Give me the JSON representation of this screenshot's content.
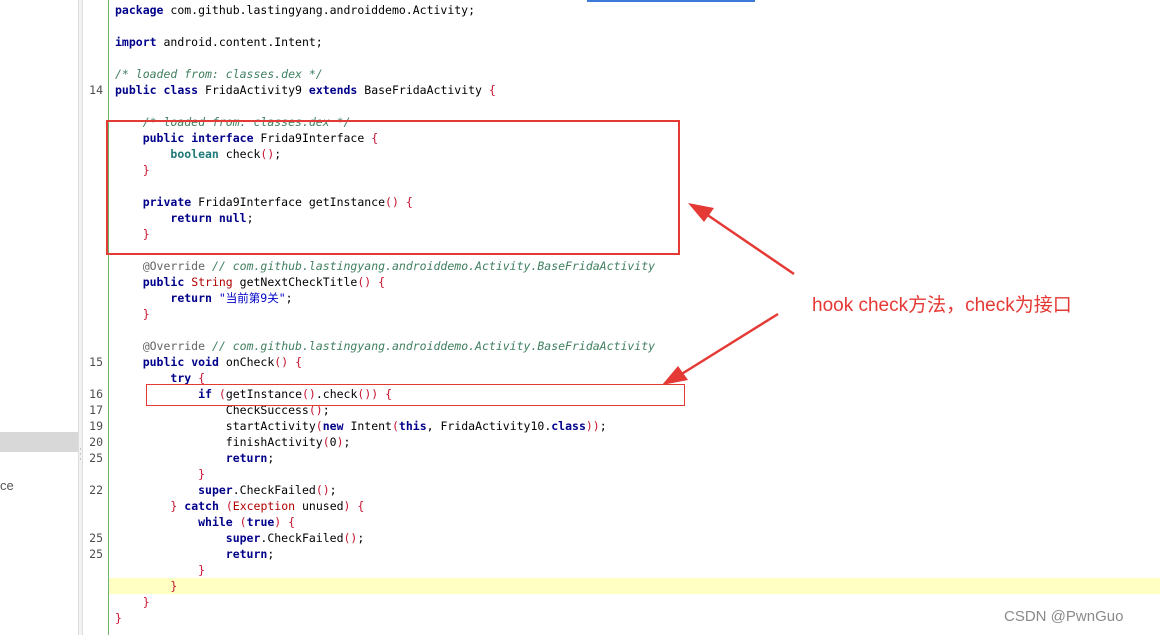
{
  "left_panel": {
    "partial_label": "ce"
  },
  "editor": {
    "lines": [
      {
        "num": "",
        "segs": [
          {
            "t": "package",
            "c": "kw"
          },
          {
            "t": " com.github.lastingyang.androiddemo.Activity;"
          }
        ]
      },
      {
        "num": "",
        "segs": []
      },
      {
        "num": "",
        "segs": [
          {
            "t": "import",
            "c": "kw"
          },
          {
            "t": " android.content.Intent;"
          }
        ]
      },
      {
        "num": "",
        "segs": []
      },
      {
        "num": "",
        "segs": [
          {
            "t": "/* loaded from: classes.dex */",
            "c": "cm"
          }
        ]
      },
      {
        "num": "14",
        "segs": [
          {
            "t": "public",
            "c": "kw"
          },
          {
            "t": " "
          },
          {
            "t": "class",
            "c": "kw"
          },
          {
            "t": " FridaActivity9 "
          },
          {
            "t": "extends",
            "c": "kw"
          },
          {
            "t": " BaseFridaActivity "
          },
          {
            "t": "{",
            "c": "rd"
          }
        ]
      },
      {
        "num": "",
        "segs": []
      },
      {
        "num": "",
        "segs": [
          {
            "t": "    "
          },
          {
            "t": "/* loaded from: classes.dex */",
            "c": "cm"
          }
        ]
      },
      {
        "num": "",
        "segs": [
          {
            "t": "    "
          },
          {
            "t": "public",
            "c": "kw"
          },
          {
            "t": " "
          },
          {
            "t": "interface",
            "c": "kw"
          },
          {
            "t": " Frida9Interface "
          },
          {
            "t": "{",
            "c": "rd"
          }
        ]
      },
      {
        "num": "",
        "segs": [
          {
            "t": "        "
          },
          {
            "t": "boolean",
            "c": "tp"
          },
          {
            "t": " check"
          },
          {
            "t": "()",
            "c": "rd"
          },
          {
            "t": ";"
          }
        ]
      },
      {
        "num": "",
        "segs": [
          {
            "t": "    "
          },
          {
            "t": "}",
            "c": "rd"
          }
        ]
      },
      {
        "num": "",
        "segs": []
      },
      {
        "num": "",
        "segs": [
          {
            "t": "    "
          },
          {
            "t": "private",
            "c": "kw"
          },
          {
            "t": " Frida9Interface getInstance"
          },
          {
            "t": "()",
            "c": "rd"
          },
          {
            "t": " "
          },
          {
            "t": "{",
            "c": "rd"
          }
        ]
      },
      {
        "num": "",
        "segs": [
          {
            "t": "        "
          },
          {
            "t": "return",
            "c": "kw"
          },
          {
            "t": " "
          },
          {
            "t": "null",
            "c": "kw"
          },
          {
            "t": ";"
          }
        ]
      },
      {
        "num": "",
        "segs": [
          {
            "t": "    "
          },
          {
            "t": "}",
            "c": "rd"
          }
        ]
      },
      {
        "num": "",
        "segs": []
      },
      {
        "num": "",
        "segs": [
          {
            "t": "    "
          },
          {
            "t": "@Override",
            "c": "an"
          },
          {
            "t": " "
          },
          {
            "t": "// com.github.lastingyang.androiddemo.Activity.BaseFridaActivity",
            "c": "cm"
          }
        ]
      },
      {
        "num": "",
        "segs": [
          {
            "t": "    "
          },
          {
            "t": "public",
            "c": "kw"
          },
          {
            "t": " "
          },
          {
            "t": "String",
            "c": "cl"
          },
          {
            "t": " getNextCheckTitle"
          },
          {
            "t": "()",
            "c": "rd"
          },
          {
            "t": " "
          },
          {
            "t": "{",
            "c": "rd"
          }
        ]
      },
      {
        "num": "",
        "segs": [
          {
            "t": "        "
          },
          {
            "t": "return",
            "c": "kw"
          },
          {
            "t": " "
          },
          {
            "t": "\"当前第9关\"",
            "c": "st"
          },
          {
            "t": ";"
          }
        ]
      },
      {
        "num": "",
        "segs": [
          {
            "t": "    "
          },
          {
            "t": "}",
            "c": "rd"
          }
        ]
      },
      {
        "num": "",
        "segs": []
      },
      {
        "num": "",
        "segs": [
          {
            "t": "    "
          },
          {
            "t": "@Override",
            "c": "an"
          },
          {
            "t": " "
          },
          {
            "t": "// com.github.lastingyang.androiddemo.Activity.BaseFridaActivity",
            "c": "cm"
          }
        ]
      },
      {
        "num": "15",
        "segs": [
          {
            "t": "    "
          },
          {
            "t": "public",
            "c": "kw"
          },
          {
            "t": " "
          },
          {
            "t": "void",
            "c": "kw"
          },
          {
            "t": " onCheck"
          },
          {
            "t": "()",
            "c": "rd"
          },
          {
            "t": " "
          },
          {
            "t": "{",
            "c": "rd"
          }
        ]
      },
      {
        "num": "",
        "segs": [
          {
            "t": "        "
          },
          {
            "t": "try",
            "c": "kw"
          },
          {
            "t": " "
          },
          {
            "t": "{",
            "c": "rd"
          }
        ]
      },
      {
        "num": "16",
        "segs": [
          {
            "t": "            "
          },
          {
            "t": "if",
            "c": "kw"
          },
          {
            "t": " "
          },
          {
            "t": "(",
            "c": "rd"
          },
          {
            "t": "getInstance"
          },
          {
            "t": "()",
            "c": "rd"
          },
          {
            "t": ".check"
          },
          {
            "t": "())",
            "c": "rd"
          },
          {
            "t": " "
          },
          {
            "t": "{",
            "c": "rd"
          }
        ]
      },
      {
        "num": "17",
        "segs": [
          {
            "t": "                CheckSuccess"
          },
          {
            "t": "()",
            "c": "rd"
          },
          {
            "t": ";"
          }
        ]
      },
      {
        "num": "19",
        "segs": [
          {
            "t": "                startActivity"
          },
          {
            "t": "(",
            "c": "rd"
          },
          {
            "t": "new",
            "c": "kw"
          },
          {
            "t": " Intent"
          },
          {
            "t": "(",
            "c": "rd"
          },
          {
            "t": "this",
            "c": "kw"
          },
          {
            "t": ", FridaActivity10."
          },
          {
            "t": "class",
            "c": "kw"
          },
          {
            "t": "))",
            "c": "rd"
          },
          {
            "t": ";"
          }
        ]
      },
      {
        "num": "20",
        "segs": [
          {
            "t": "                finishActivity"
          },
          {
            "t": "(",
            "c": "rd"
          },
          {
            "t": "0"
          },
          {
            "t": ")",
            "c": "rd"
          },
          {
            "t": ";"
          }
        ]
      },
      {
        "num": "25",
        "segs": [
          {
            "t": "                "
          },
          {
            "t": "return",
            "c": "kw"
          },
          {
            "t": ";"
          }
        ]
      },
      {
        "num": "",
        "segs": [
          {
            "t": "            "
          },
          {
            "t": "}",
            "c": "rd"
          }
        ]
      },
      {
        "num": "22",
        "segs": [
          {
            "t": "            "
          },
          {
            "t": "super",
            "c": "kw"
          },
          {
            "t": ".CheckFailed"
          },
          {
            "t": "()",
            "c": "rd"
          },
          {
            "t": ";"
          }
        ]
      },
      {
        "num": "",
        "segs": [
          {
            "t": "        "
          },
          {
            "t": "}",
            "c": "rd"
          },
          {
            "t": " "
          },
          {
            "t": "catch",
            "c": "kw"
          },
          {
            "t": " "
          },
          {
            "t": "(",
            "c": "rd"
          },
          {
            "t": "Exception",
            "c": "cl"
          },
          {
            "t": " unused"
          },
          {
            "t": ")",
            "c": "rd"
          },
          {
            "t": " "
          },
          {
            "t": "{",
            "c": "rd"
          }
        ]
      },
      {
        "num": "",
        "segs": [
          {
            "t": "            "
          },
          {
            "t": "while",
            "c": "kw"
          },
          {
            "t": " "
          },
          {
            "t": "(",
            "c": "rd"
          },
          {
            "t": "true",
            "c": "kw"
          },
          {
            "t": ")",
            "c": "rd"
          },
          {
            "t": " "
          },
          {
            "t": "{",
            "c": "rd"
          }
        ]
      },
      {
        "num": "25",
        "segs": [
          {
            "t": "                "
          },
          {
            "t": "super",
            "c": "kw"
          },
          {
            "t": ".CheckFailed"
          },
          {
            "t": "()",
            "c": "rd"
          },
          {
            "t": ";"
          }
        ]
      },
      {
        "num": "25",
        "segs": [
          {
            "t": "                "
          },
          {
            "t": "return",
            "c": "kw"
          },
          {
            "t": ";"
          }
        ]
      },
      {
        "num": "",
        "segs": [
          {
            "t": "            "
          },
          {
            "t": "}",
            "c": "rd"
          }
        ]
      },
      {
        "num": "",
        "segs": [
          {
            "t": "        "
          },
          {
            "t": "}",
            "c": "rd"
          }
        ]
      },
      {
        "num": "",
        "segs": [
          {
            "t": "    "
          },
          {
            "t": "}",
            "c": "rd"
          }
        ]
      },
      {
        "num": "",
        "segs": [
          {
            "t": "}",
            "c": "rd"
          }
        ]
      }
    ],
    "current_line": 36
  },
  "annotation": {
    "text": "hook check方法，check为接口",
    "color": "#e53935"
  },
  "watermark": "CSDN @PwnGuo"
}
